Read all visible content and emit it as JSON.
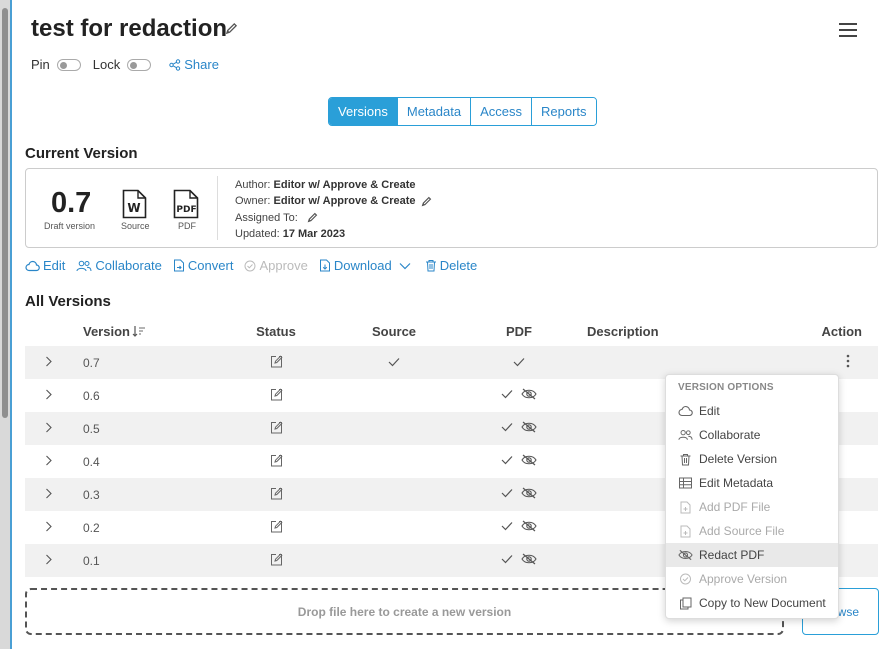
{
  "document": {
    "title": "test for redaction"
  },
  "toggles": {
    "pin_label": "Pin",
    "lock_label": "Lock",
    "share_label": "Share"
  },
  "tabs": [
    {
      "label": "Versions",
      "active": true
    },
    {
      "label": "Metadata",
      "active": false
    },
    {
      "label": "Access",
      "active": false
    },
    {
      "label": "Reports",
      "active": false
    }
  ],
  "current_version": {
    "section_title": "Current Version",
    "number": "0.7",
    "status": "Draft version",
    "source_label": "Source",
    "pdf_label": "PDF",
    "author_label": "Author:",
    "author": "Editor w/ Approve & Create",
    "owner_label": "Owner:",
    "owner": "Editor w/ Approve & Create",
    "assigned_label": "Assigned To:",
    "updated_label": "Updated:",
    "updated": "17 Mar 2023"
  },
  "actions": {
    "edit": "Edit",
    "collaborate": "Collaborate",
    "convert": "Convert",
    "approve": "Approve",
    "download": "Download",
    "delete": "Delete"
  },
  "all_versions": {
    "section_title": "All Versions",
    "columns": [
      "Version",
      "Status",
      "Source",
      "PDF",
      "Description",
      "Action"
    ],
    "rows": [
      {
        "version": "0.7",
        "source_check": true,
        "pdf_check": true,
        "redacted": false
      },
      {
        "version": "0.6",
        "source_check": false,
        "pdf_check": true,
        "redacted": true
      },
      {
        "version": "0.5",
        "source_check": false,
        "pdf_check": true,
        "redacted": true
      },
      {
        "version": "0.4",
        "source_check": false,
        "pdf_check": true,
        "redacted": true
      },
      {
        "version": "0.3",
        "source_check": false,
        "pdf_check": true,
        "redacted": true
      },
      {
        "version": "0.2",
        "source_check": false,
        "pdf_check": true,
        "redacted": true
      },
      {
        "version": "0.1",
        "source_check": false,
        "pdf_check": true,
        "redacted": true
      }
    ]
  },
  "dropzone": {
    "text": "Drop file here to create a new version",
    "browse_label": "owse"
  },
  "version_menu": {
    "header": "VERSION OPTIONS",
    "items": [
      {
        "label": "Edit",
        "icon": "cloud-icon",
        "disabled": false
      },
      {
        "label": "Collaborate",
        "icon": "users-icon",
        "disabled": false
      },
      {
        "label": "Delete Version",
        "icon": "trash-icon",
        "disabled": false
      },
      {
        "label": "Edit Metadata",
        "icon": "table-icon",
        "disabled": false
      },
      {
        "label": "Add PDF File",
        "icon": "file-plus-icon",
        "disabled": true
      },
      {
        "label": "Add Source File",
        "icon": "file-plus-icon",
        "disabled": true
      },
      {
        "label": "Redact PDF",
        "icon": "eye-slash-icon",
        "disabled": false,
        "highlighted": true
      },
      {
        "label": "Approve Version",
        "icon": "check-circle-icon",
        "disabled": true
      },
      {
        "label": "Copy to New Document",
        "icon": "copy-icon",
        "disabled": false
      }
    ]
  }
}
